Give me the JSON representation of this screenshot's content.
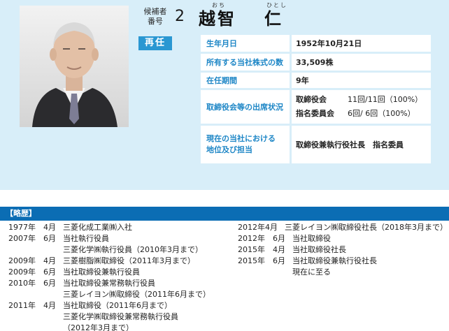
{
  "candidate": {
    "label_line1": "候補者",
    "label_line2": "番号",
    "number": "2",
    "name_family": "越智",
    "name_given": "仁",
    "ruby_family": "おち",
    "ruby_given": "ひとし",
    "status": "再任"
  },
  "info": {
    "birth_label": "生年月日",
    "birth_value": "1952年10月21日",
    "shares_label": "所有する当社株式の数",
    "shares_value": "33,509株",
    "tenure_label": "在任期間",
    "tenure_value": "9年",
    "attendance_label": "取締役会等の出席状況",
    "attendance": [
      {
        "label": "取締役会",
        "value": "11回/11回（100%）"
      },
      {
        "label": "指名委員会",
        "value": "6回/ 6回（100%）"
      }
    ],
    "position_label_line1": "現在の当社における",
    "position_label_line2": "地位及び担当",
    "position_value": "取締役兼執行役社長　指名委員"
  },
  "career": {
    "header": "【略歴】",
    "left": [
      {
        "year": "1977年",
        "month": "4月",
        "text": "三菱化成工業㈱入社"
      },
      {
        "year": "2007年",
        "month": "6月",
        "text": "当社執行役員"
      },
      {
        "year": "",
        "month": "",
        "text": "三菱化学㈱執行役員（2010年3月まで）"
      },
      {
        "year": "2009年",
        "month": "4月",
        "text": "三菱樹脂㈱取締役（2011年3月まで）"
      },
      {
        "year": "2009年",
        "month": "6月",
        "text": "当社取締役兼執行役員"
      },
      {
        "year": "2010年",
        "month": "6月",
        "text": "当社取締役兼常務執行役員"
      },
      {
        "year": "",
        "month": "",
        "text": "三菱レイヨン㈱取締役（2011年6月まで）"
      },
      {
        "year": "2011年",
        "month": "4月",
        "text": "当社取締役（2011年6月まで）"
      },
      {
        "year": "",
        "month": "",
        "text": "三菱化学㈱取締役兼常務執行役員"
      },
      {
        "year": "",
        "month": "",
        "text": "（2012年3月まで）"
      }
    ],
    "right": [
      {
        "year": "2012年",
        "month": "4月",
        "text": "三菱レイヨン㈱取締役社長（2018年3月まで）"
      },
      {
        "year": "2012年",
        "month": "6月",
        "text": "当社取締役"
      },
      {
        "year": "2015年",
        "month": "4月",
        "text": "当社取締役社長"
      },
      {
        "year": "2015年",
        "month": "6月",
        "text": "当社取締役兼執行役社長"
      },
      {
        "year": "",
        "month": "",
        "text": "現在に至る"
      }
    ]
  },
  "colors": {
    "panel_bg": "#d8eef9",
    "accent_blue": "#1d86c6",
    "badge_blue": "#2a97d2",
    "header_blue": "#0b6db4"
  }
}
